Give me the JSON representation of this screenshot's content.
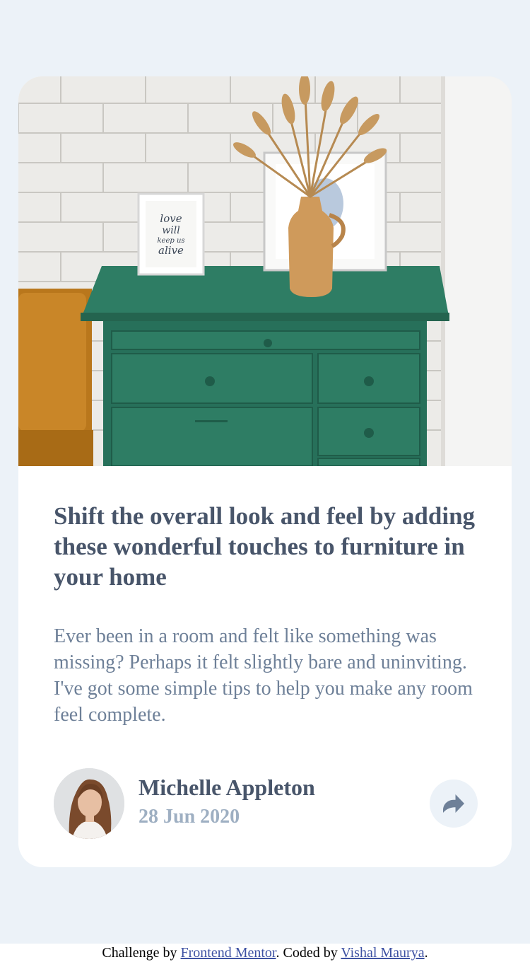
{
  "article": {
    "title": "Shift the overall look and feel by adding these wonderful touches to furniture in your home",
    "description": "Ever been in a room and felt like something was missing? Perhaps it felt slightly bare and uninviting. I've got some simple tips to help you make any room feel complete.",
    "image_icon": "drawers-photo",
    "frame_text": [
      "love",
      "will",
      "keep us",
      "alive"
    ]
  },
  "author": {
    "name": "Michelle Appleton",
    "date": "28 Jun 2020",
    "avatar_icon": "avatar-photo"
  },
  "share": {
    "icon": "share-arrow-icon"
  },
  "attribution": {
    "prefix": "Challenge by ",
    "link1": "Frontend Mentor",
    "middle": ". Coded by ",
    "link2": "Vishal Maurya",
    "suffix": "."
  },
  "colors": {
    "page_background": "#ecf2f8",
    "card_background": "#ffffff",
    "heading": "#48556a",
    "body_text": "#6e8098",
    "date_text": "#9eafc2",
    "link": "#3e52a3",
    "drawer_green": "#2e7d64"
  }
}
